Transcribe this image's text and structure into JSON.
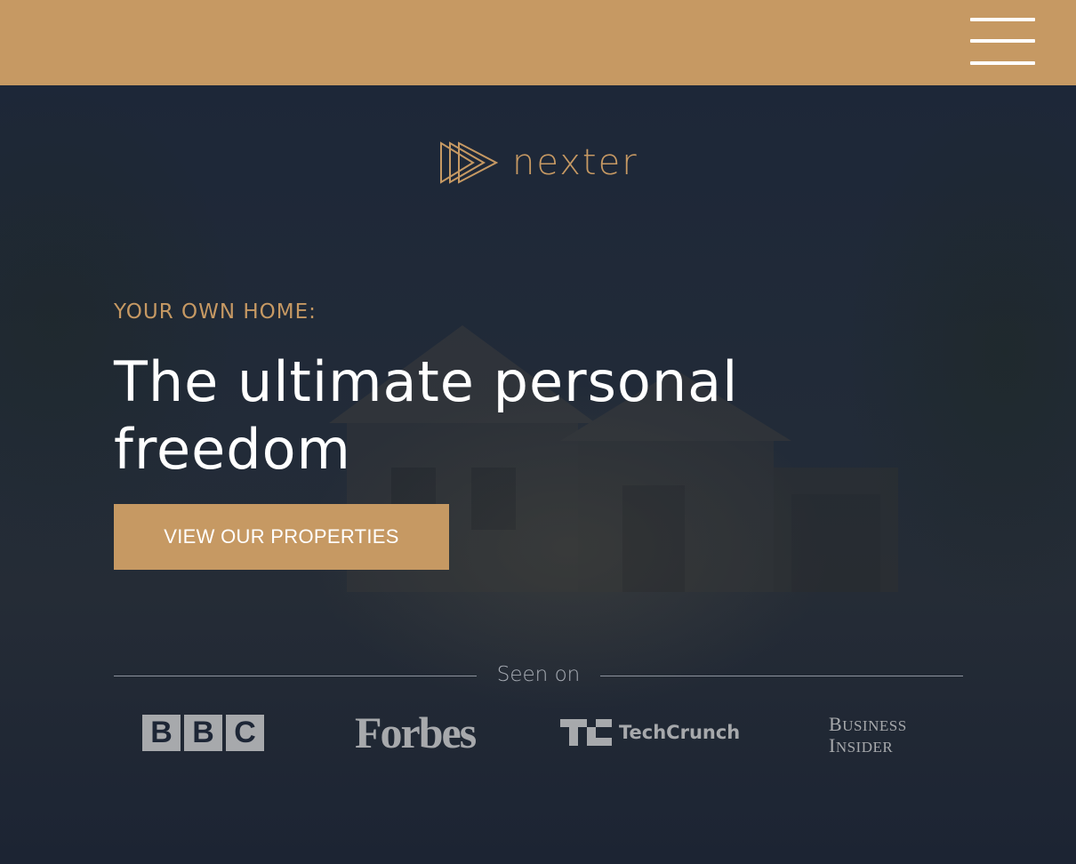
{
  "header": {
    "menu_icon": "hamburger-menu-icon",
    "colors": {
      "bar": "#c69963",
      "icon": "#ffffff"
    }
  },
  "hero": {
    "brand": "nexter",
    "brand_icon": "triple-play-triangle-icon",
    "subtitle": "YOUR OWN HOME:",
    "headline_line1": "The ultimate personal",
    "headline_line2": "freedom",
    "cta_label": "VIEW OUR PROPERTIES",
    "colors": {
      "accent": "#c69963",
      "overlay": "#1b2536",
      "text": "#ffffff"
    }
  },
  "seen_on": {
    "label": "Seen on",
    "press": [
      {
        "name": "BBC",
        "letters": [
          "B",
          "B",
          "C"
        ]
      },
      {
        "name": "Forbes"
      },
      {
        "name": "TechCrunch",
        "mark": "TC"
      },
      {
        "name": "Business Insider",
        "line1_cap": "B",
        "line1_rest": "USINESS",
        "line2_cap": "I",
        "line2_rest": "NSIDER"
      }
    ]
  }
}
